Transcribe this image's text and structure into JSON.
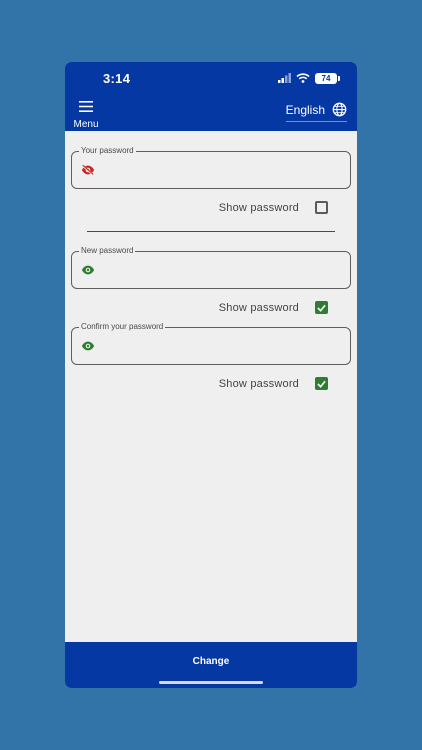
{
  "status_bar": {
    "time": "3:14",
    "battery": "74"
  },
  "header": {
    "menu_label": "Menu",
    "menu_icon": "hamburger-icon",
    "language_label": "English",
    "language_icon": "globe-icon"
  },
  "form": {
    "fields": [
      {
        "label": "Your password",
        "value": "",
        "icon": "eye-off-icon",
        "icon_color": "#c62828",
        "show_password_label": "Show password",
        "show_password_checked": false
      },
      {
        "label": "New password",
        "value": "",
        "icon": "eye-icon",
        "icon_color": "#2e7d32",
        "show_password_label": "Show password",
        "show_password_checked": true
      },
      {
        "label": "Confirm your password",
        "value": "",
        "icon": "eye-icon",
        "icon_color": "#2e7d32",
        "show_password_label": "Show password",
        "show_password_checked": true
      }
    ]
  },
  "footer": {
    "change_label": "Change"
  },
  "colors": {
    "primary": "#0638a4",
    "background": "#3374a8",
    "surface": "#efefef",
    "checkbox_on": "#2e7d32",
    "error": "#c62828"
  }
}
